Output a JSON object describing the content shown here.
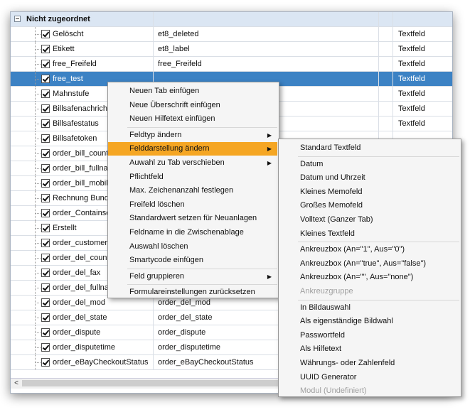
{
  "group_label": "Nicht zugeordnet",
  "rows": [
    {
      "name": "Gelöscht",
      "field": "et8_deleted",
      "type": "Textfeld",
      "selected": false
    },
    {
      "name": "Etikett",
      "field": "et8_label",
      "type": "Textfeld",
      "selected": false
    },
    {
      "name": "free_Freifeld",
      "field": "free_Freifeld",
      "type": "Textfeld",
      "selected": false
    },
    {
      "name": "free_test",
      "field": "",
      "type": "Textfeld",
      "selected": true
    },
    {
      "name": "Mahnstufe",
      "field": "",
      "type": "Textfeld",
      "selected": false
    },
    {
      "name": "Billsafenachricht",
      "field": "",
      "type": "Textfeld",
      "selected": false
    },
    {
      "name": "Billsafestatus",
      "field": "",
      "type": "Textfeld",
      "selected": false
    },
    {
      "name": "Billsafetoken",
      "field": "",
      "type": "",
      "selected": false
    },
    {
      "name": "order_bill_country",
      "field": "",
      "type": "",
      "selected": false
    },
    {
      "name": "order_bill_fullname",
      "field": "",
      "type": "",
      "selected": false
    },
    {
      "name": "order_bill_mobile",
      "field": "",
      "type": "",
      "selected": false
    },
    {
      "name": "Rechnung Bundes",
      "field": "",
      "type": "",
      "selected": false
    },
    {
      "name": "order_ContainseB",
      "field": "",
      "type": "",
      "selected": false
    },
    {
      "name": "Erstellt",
      "field": "",
      "type": "",
      "selected": false
    },
    {
      "name": "order_customernu",
      "field": "",
      "type": "",
      "selected": false
    },
    {
      "name": "order_del_country",
      "field": "",
      "type": "",
      "selected": false
    },
    {
      "name": "order_del_fax",
      "field": "",
      "type": "",
      "selected": false
    },
    {
      "name": "order_del_fullname",
      "field": "",
      "type": "",
      "selected": false
    },
    {
      "name": "order_del_mod",
      "field": "order_del_mod",
      "type": "",
      "selected": false
    },
    {
      "name": "order_del_state",
      "field": "order_del_state",
      "type": "",
      "selected": false
    },
    {
      "name": "order_dispute",
      "field": "order_dispute",
      "type": "",
      "selected": false
    },
    {
      "name": "order_disputetime",
      "field": "order_disputetime",
      "type": "",
      "selected": false
    },
    {
      "name": "order_eBayCheckoutStatus",
      "field": "order_eBayCheckoutStatus",
      "type": "",
      "selected": false
    }
  ],
  "scroll_left_arrow": "<",
  "context_menu": [
    {
      "label": "Neuen Tab einfügen",
      "submenu": false,
      "highlighted": false,
      "sep_before": false
    },
    {
      "label": "Neue Überschrift einfügen",
      "submenu": false,
      "highlighted": false,
      "sep_before": false
    },
    {
      "label": "Neuen Hilfetext einfügen",
      "submenu": false,
      "highlighted": false,
      "sep_before": false
    },
    {
      "label": "Feldtyp ändern",
      "submenu": true,
      "highlighted": false,
      "sep_before": true
    },
    {
      "label": "Felddarstellung ändern",
      "submenu": true,
      "highlighted": true,
      "sep_before": false
    },
    {
      "label": "Auwahl zu Tab verschieben",
      "submenu": true,
      "highlighted": false,
      "sep_before": false
    },
    {
      "label": "Pflichtfeld",
      "submenu": false,
      "highlighted": false,
      "sep_before": false
    },
    {
      "label": "Max. Zeichenanzahl festlegen",
      "submenu": false,
      "highlighted": false,
      "sep_before": false
    },
    {
      "label": "Freifeld löschen",
      "submenu": false,
      "highlighted": false,
      "sep_before": false
    },
    {
      "label": "Standardwert setzen für Neuanlagen",
      "submenu": false,
      "highlighted": false,
      "sep_before": false
    },
    {
      "label": "Feldname in die Zwischenablage",
      "submenu": false,
      "highlighted": false,
      "sep_before": false
    },
    {
      "label": "Auswahl löschen",
      "submenu": false,
      "highlighted": false,
      "sep_before": false
    },
    {
      "label": "Smartycode einfügen",
      "submenu": false,
      "highlighted": false,
      "sep_before": false
    },
    {
      "label": "Feld gruppieren",
      "submenu": true,
      "highlighted": false,
      "sep_before": true
    },
    {
      "label": "Formulareinstellungen zurücksetzen",
      "submenu": false,
      "highlighted": false,
      "sep_before": true
    }
  ],
  "submenu_arrow": "▶",
  "submenu": [
    {
      "label": "Standard Textfeld",
      "disabled": false,
      "sep_before": false
    },
    {
      "label": "Datum",
      "disabled": false,
      "sep_before": true
    },
    {
      "label": "Datum und Uhrzeit",
      "disabled": false,
      "sep_before": false
    },
    {
      "label": "Kleines Memofeld",
      "disabled": false,
      "sep_before": false
    },
    {
      "label": "Großes Memofeld",
      "disabled": false,
      "sep_before": false
    },
    {
      "label": "Volltext (Ganzer Tab)",
      "disabled": false,
      "sep_before": false
    },
    {
      "label": "Kleines Textfeld",
      "disabled": false,
      "sep_before": false
    },
    {
      "label": "Ankreuzbox (An=\"1\", Aus=\"0\")",
      "disabled": false,
      "sep_before": true
    },
    {
      "label": "Ankreuzbox (An=\"true\", Aus=\"false\")",
      "disabled": false,
      "sep_before": false
    },
    {
      "label": "Ankreuzbox (An=\"\", Aus=\"none\")",
      "disabled": false,
      "sep_before": false
    },
    {
      "label": "Ankreuzgruppe",
      "disabled": true,
      "sep_before": false
    },
    {
      "label": "In Bildauswahl",
      "disabled": false,
      "sep_before": true
    },
    {
      "label": "Als eigenständige Bildwahl",
      "disabled": false,
      "sep_before": false
    },
    {
      "label": "Passwortfeld",
      "disabled": false,
      "sep_before": false
    },
    {
      "label": "Als Hilfetext",
      "disabled": false,
      "sep_before": false
    },
    {
      "label": "Währungs- oder Zahlenfeld",
      "disabled": false,
      "sep_before": false
    },
    {
      "label": "UUID Generator",
      "disabled": false,
      "sep_before": false
    },
    {
      "label": "Modul (Undefiniert)",
      "disabled": true,
      "sep_before": false
    }
  ]
}
